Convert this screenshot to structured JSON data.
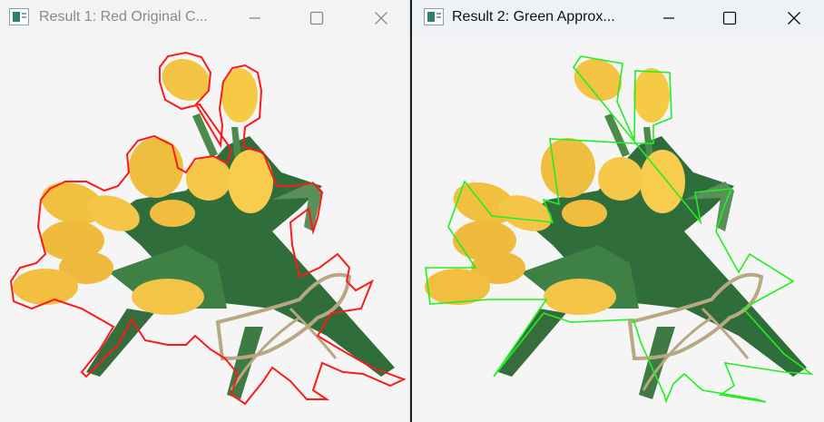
{
  "windows": [
    {
      "title": "Result 1: Red Original C...",
      "icon": "window-app-icon",
      "state": "inactive",
      "contour_color": "#ff1a1a",
      "controls": [
        "minimize-icon",
        "maximize-icon",
        "close-icon"
      ]
    },
    {
      "title": "Result 2: Green Approx...",
      "icon": "window-app-icon",
      "state": "active",
      "contour_color": "#22ee22",
      "controls": [
        "minimize-icon",
        "maximize-icon",
        "close-icon"
      ]
    }
  ],
  "image": {
    "subject": "yellow tulip bouquet"
  }
}
